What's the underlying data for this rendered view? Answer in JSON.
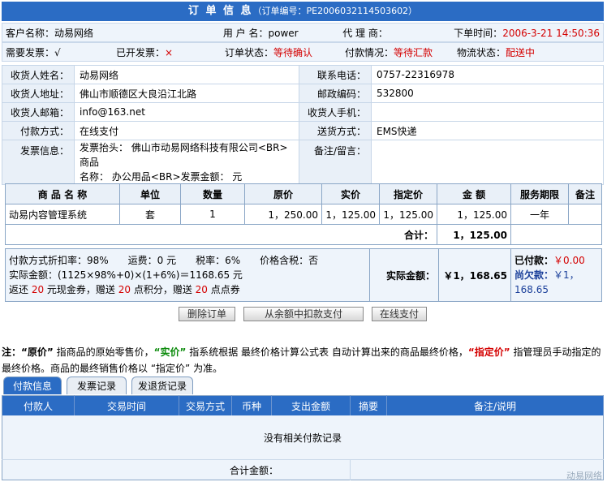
{
  "title": {
    "main": "订 单 信 息",
    "order_no": "（订单编号：PE2006032114503602）"
  },
  "header": {
    "row1": {
      "customer_label": "客户名称：",
      "customer": "动易网络",
      "user_label": "用 户 名：",
      "user": "power",
      "agent_label": "代 理 商：",
      "agent": "",
      "time_label": "下单时间：",
      "time": "2006-3-21 14:50:36"
    },
    "row2": {
      "invoice_need_label": "需要发票：",
      "invoice_need": "√",
      "invoice_issued_label": "已开发票：",
      "invoice_issued": "×",
      "status_label": "订单状态：",
      "status": "等待确认",
      "pay_label": "付款情况：",
      "pay": "等待汇款",
      "ship_label": "物流状态：",
      "ship": "配送中"
    }
  },
  "info": {
    "name_label": "收货人姓名：",
    "name": "动易网络",
    "phone_label": "联系电话：",
    "phone": "0757-22316978",
    "addr_label": "收货人地址：",
    "addr": "佛山市顺德区大良沿江北路",
    "zip_label": "邮政编码：",
    "zip": "532800",
    "email_label": "收货人邮箱：",
    "email": "info@163.net",
    "mobile_label": "收货人手机：",
    "mobile": "",
    "paymethod_label": "付款方式：",
    "paymethod": "在线支付",
    "shipmethod_label": "送货方式：",
    "shipmethod": "EMS快递",
    "invoice_label": "发票信息：",
    "invoice_line1": "发票抬头： 佛山市动易网络科技有限公司<BR>商品",
    "invoice_line2": "名称： 办公用品<BR>发票金额： 元",
    "remark_label": "备注/留言：",
    "remark": ""
  },
  "products": {
    "headers": [
      "商 品 名 称",
      "单位",
      "数量",
      "原价",
      "实价",
      "指定价",
      "金 额",
      "服务期限",
      "备注"
    ],
    "rows": [
      {
        "name": "动易内容管理系统",
        "unit": "套",
        "qty": "1",
        "orig": "1，250.00",
        "real": "1，125.00",
        "fixed": "1，125.00",
        "amount": "1，125.00",
        "term": "一年",
        "note": ""
      }
    ],
    "total_label": "合计：",
    "total": "1，125.00"
  },
  "summary": {
    "line1": "付款方式折扣率：98%　　运费：0 元　　税率：6%　　价格含税：否",
    "line2": "实际金额：(1125×98%+0)×(1+6%)＝1168.65 元",
    "line3_a": "返还 ",
    "line3_b": "20",
    "line3_c": " 元现金券，赠送 ",
    "line3_d": "20",
    "line3_e": " 点积分，赠送 ",
    "line3_f": "20",
    "line3_g": " 点点券",
    "actual_label": "实际金额：",
    "actual": "￥1，168.65",
    "paid_label": "已付款：",
    "paid": "￥0.00",
    "owe_label": "尚欠款：",
    "owe": "￥1，168.65"
  },
  "buttons": {
    "delete": "删除订单",
    "balance": "从余额中扣款支付",
    "online": "在线支付"
  },
  "note": {
    "prefix": "注：",
    "q1": "“原价”",
    "t1": " 指商品的原始零售价，",
    "q2": "“实价”",
    "t2": " 指系统根据 最终价格计算公式表 自动计算出来的商品最终价格，",
    "q3": "“指定价”",
    "t3": " 指管理员手动指定的最终价格。商品的最终销售价格以 “指定价” 为准。"
  },
  "tabs": [
    "付款信息",
    "发票记录",
    "发退货记录"
  ],
  "payments": {
    "headers": [
      "付款人",
      "交易时间",
      "交易方式",
      "币种",
      "支出金额",
      "摘要",
      "备注/说明"
    ],
    "empty": "没有相关付款记录",
    "total_label": "合计金额："
  },
  "footer": "动易网络",
  "colors": {
    "accent": "#2b6cc4",
    "alert": "#d40000",
    "header_bg": "#eef4fb"
  }
}
